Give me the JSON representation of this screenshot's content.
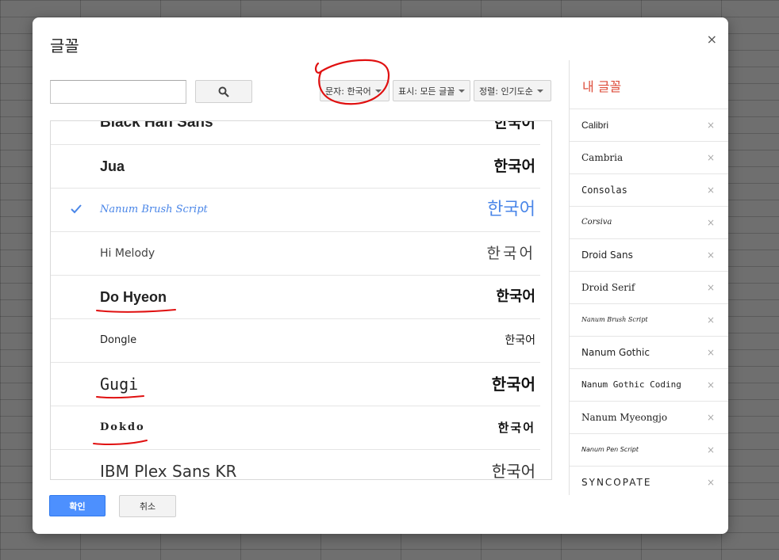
{
  "dialog": {
    "title": "글꼴",
    "close_glyph": "×",
    "search": {
      "value": "",
      "placeholder": ""
    },
    "search_icon": "search-icon",
    "filters": {
      "script": "문자: 한국어",
      "show": "표시: 모든 글꼴",
      "sort": "정렬: 인기도순"
    },
    "fonts": [
      {
        "name": "Black Han Sans",
        "sample": "한국어",
        "selected": false
      },
      {
        "name": "Jua",
        "sample": "한국어",
        "selected": false
      },
      {
        "name": "Nanum Brush Script",
        "sample": "한국어",
        "selected": true
      },
      {
        "name": "Hi Melody",
        "sample": "한국어",
        "selected": false
      },
      {
        "name": "Do Hyeon",
        "sample": "한국어",
        "selected": false
      },
      {
        "name": "Dongle",
        "sample": "한국어",
        "selected": false
      },
      {
        "name": "Gugi",
        "sample": "한국어",
        "selected": false
      },
      {
        "name": "Dokdo",
        "sample": "한국어",
        "selected": false
      },
      {
        "name": "IBM Plex Sans KR",
        "sample": "한국어",
        "selected": false
      }
    ],
    "my_fonts": {
      "title": "내 글꼴",
      "items": [
        "Calibri",
        "Cambria",
        "Consolas",
        "Corsiva",
        "Droid Sans",
        "Droid Serif",
        "Nanum Brush Script",
        "Nanum Gothic",
        "Nanum Gothic Coding",
        "Nanum Myeongjo",
        "Nanum Pen Script",
        "SYNCOPATE"
      ],
      "remove_glyph": "×"
    },
    "ok_label": "확인",
    "cancel_label": "취소"
  },
  "colors": {
    "accent_blue": "#4a86e8",
    "primary_button": "#4d90fe",
    "my_fonts_title": "#dd4b39",
    "annotation_red": "#e01010"
  }
}
